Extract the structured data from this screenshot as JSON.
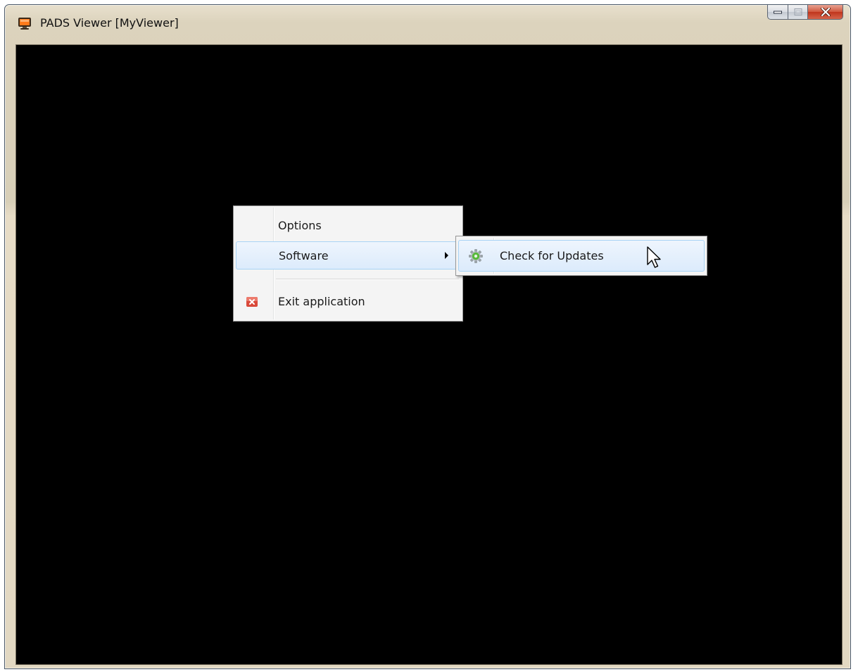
{
  "window": {
    "title": "PADS Viewer [MyViewer]",
    "icon": "app-monitor-icon",
    "caption_buttons": [
      "minimize-icon",
      "maximize-icon",
      "close-icon"
    ]
  },
  "context_menu": {
    "items": [
      {
        "label": "Options",
        "icon": null
      },
      {
        "label": "Software",
        "icon": null,
        "has_submenu": true,
        "highlighted": true
      },
      {
        "label": "Exit application",
        "icon": "exit-icon"
      }
    ]
  },
  "submenu": {
    "items": [
      {
        "label": "Check for Updates",
        "icon": "gear-icon",
        "highlighted": true
      }
    ]
  },
  "colors": {
    "client_background": "#000000",
    "menu_background": "#f4f4f4",
    "highlight_border": "#a8d3f5",
    "close_button": "#c8452b"
  }
}
